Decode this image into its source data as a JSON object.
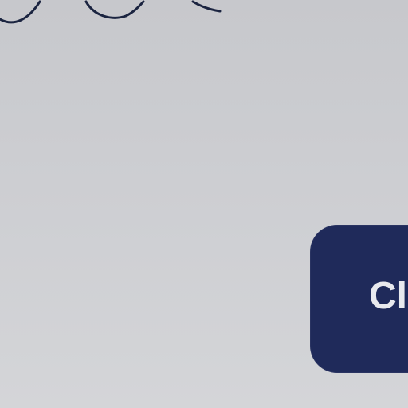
{
  "button": {
    "label": "Cl"
  },
  "colors": {
    "background": "#cdced2",
    "button_fill": "#1f2a5a",
    "button_text": "#e8e9ee",
    "stroke": "#1b2440"
  },
  "decoration": {
    "icon": "squiggle-stroke"
  }
}
